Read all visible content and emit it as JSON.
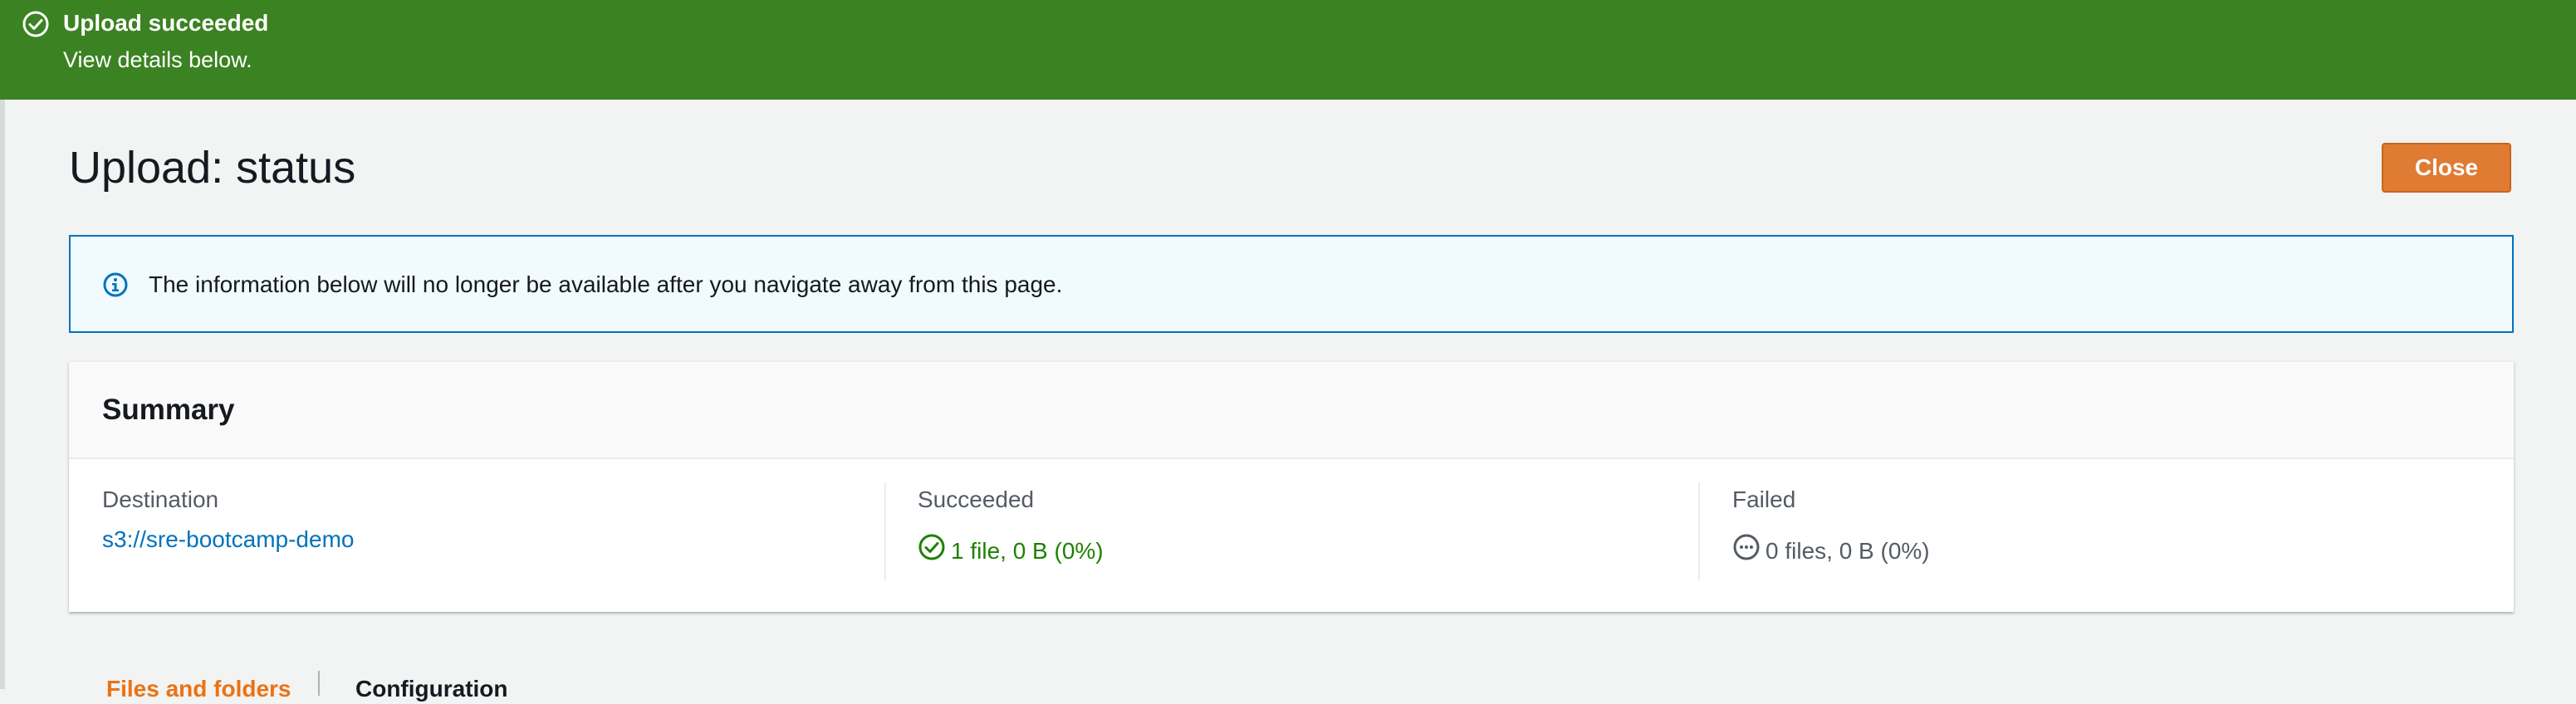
{
  "flash": {
    "title": "Upload succeeded",
    "subtitle": "View details below.",
    "icon": "check-circle-icon",
    "color": "#3b8222"
  },
  "header": {
    "title": "Upload: status",
    "close_label": "Close",
    "accent": "#e07b33"
  },
  "info_alert": {
    "icon": "info-icon",
    "text": "The information below will no longer be available after you navigate away from this page."
  },
  "summary": {
    "title": "Summary",
    "destination": {
      "label": "Destination",
      "value": "s3://sre-bootcamp-demo"
    },
    "succeeded": {
      "label": "Succeeded",
      "value": "1 file, 0 B (0%)",
      "icon": "check-circle-icon",
      "color": "#1d8102"
    },
    "failed": {
      "label": "Failed",
      "value": "0 files, 0 B (0%)",
      "icon": "ellipsis-circle-icon"
    }
  },
  "tabs": [
    {
      "label": "Files and folders",
      "active": true
    },
    {
      "label": "Configuration",
      "active": false
    }
  ]
}
